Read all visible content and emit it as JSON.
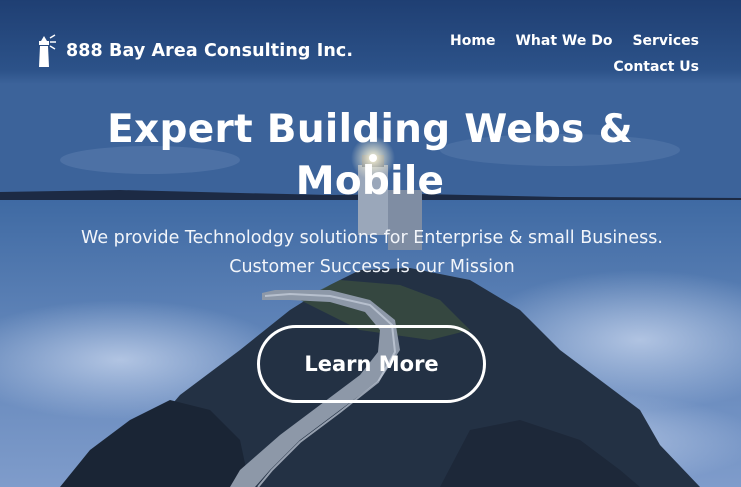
{
  "brand": {
    "name": "888 Bay Area Consulting Inc.",
    "logo_icon": "lighthouse-icon"
  },
  "nav": {
    "items": [
      {
        "label": "Home"
      },
      {
        "label": "What We Do"
      },
      {
        "label": "Services"
      },
      {
        "label": "Contact Us"
      }
    ]
  },
  "hero": {
    "headline": "Expert Building Webs & Mobile",
    "subtext": "We provide Technolodgy solutions for Enterprise & small Business. Customer Success is our Mission",
    "cta_label": "Learn More",
    "background": "lighthouse-at-dusk-photo"
  },
  "colors": {
    "text": "#ffffff",
    "sky": "#2b4f86",
    "sea": "#6f8fbf",
    "rock": "#1a2535"
  }
}
